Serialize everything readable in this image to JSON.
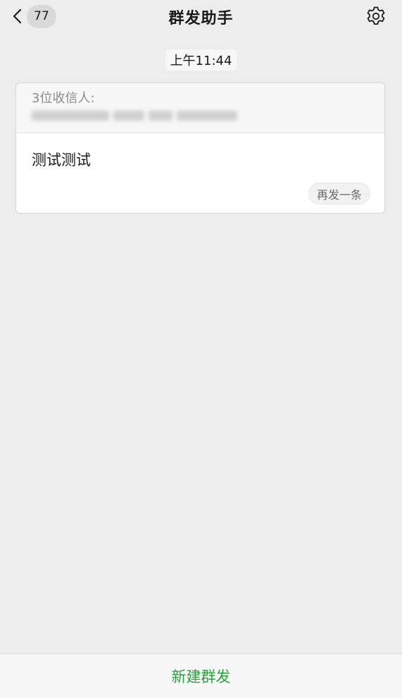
{
  "header": {
    "title": "群发助手",
    "unread_count": "77",
    "back_icon": "chevron-left-icon",
    "settings_icon": "gear-icon"
  },
  "timestamp": "上午11:44",
  "card": {
    "recipients_label": "3位收信人:",
    "message": "测试测试",
    "resend_label": "再发一条"
  },
  "bottom_bar": {
    "new_broadcast_label": "新建群发",
    "accent_color": "#27a13a"
  }
}
